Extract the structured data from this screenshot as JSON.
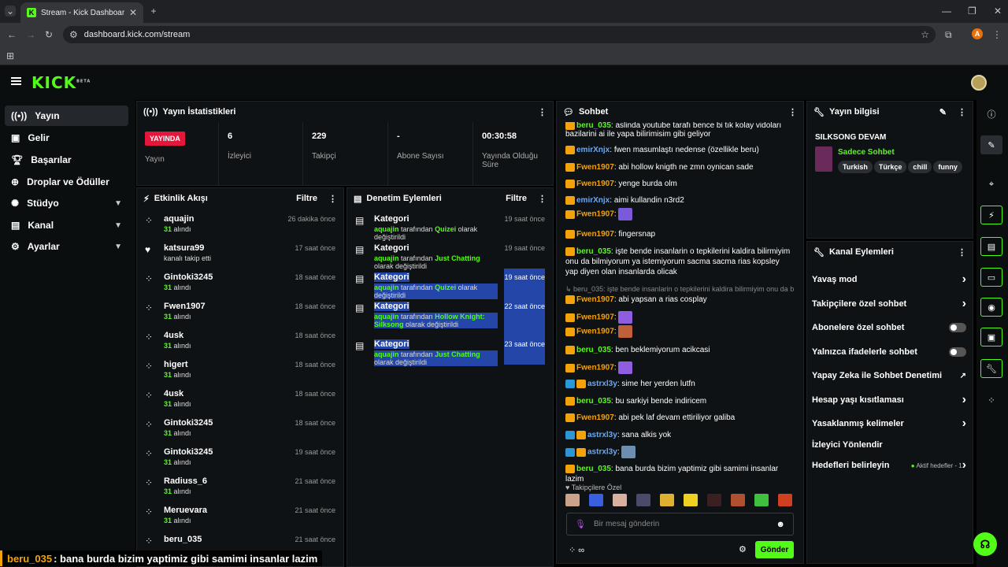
{
  "browser": {
    "tab_title": "Stream - Kick Dashboard",
    "url": "dashboard.kick.com/stream",
    "profile_initial": "A"
  },
  "header": {
    "logo": "KICK",
    "logo_badge": "BETA"
  },
  "sidebar": {
    "items": [
      {
        "label": "Yayın"
      },
      {
        "label": "Gelir"
      },
      {
        "label": "Başarılar"
      },
      {
        "label": "Droplar ve Ödüller"
      },
      {
        "label": "Stüdyo"
      },
      {
        "label": "Kanal"
      },
      {
        "label": "Ayarlar"
      }
    ]
  },
  "stats": {
    "title": "Yayın İstatistikleri",
    "live_badge": "YAYINDA",
    "live_label": "Yayın",
    "viewers": "6",
    "viewers_label": "İzleyici",
    "followers": "229",
    "followers_label": "Takipçi",
    "subs": "-",
    "subs_label": "Abone Sayısı",
    "duration": "00:30:58",
    "duration_label": "Yayında Olduğu Süre"
  },
  "activity": {
    "title": "Etkinlik Akışı",
    "filter": "Filtre",
    "items": [
      {
        "name": "aquajin",
        "amount": "31",
        "suffix": "alındı",
        "time": "26 dakika önce",
        "icon": "dots"
      },
      {
        "name": "katsura99",
        "sub": "kanalı takip etti",
        "time": "17 saat önce",
        "icon": "heart"
      },
      {
        "name": "Gintoki3245",
        "amount": "31",
        "suffix": "alındı",
        "time": "18 saat önce",
        "icon": "dots"
      },
      {
        "name": "Fwen1907",
        "amount": "31",
        "suffix": "alındı",
        "time": "18 saat önce",
        "icon": "dots"
      },
      {
        "name": "4usk",
        "amount": "31",
        "suffix": "alındı",
        "time": "18 saat önce",
        "icon": "dots"
      },
      {
        "name": "higert",
        "amount": "31",
        "suffix": "alındı",
        "time": "18 saat önce",
        "icon": "dots"
      },
      {
        "name": "4usk",
        "amount": "31",
        "suffix": "alındı",
        "time": "18 saat önce",
        "icon": "dots"
      },
      {
        "name": "Gintoki3245",
        "amount": "31",
        "suffix": "alındı",
        "time": "18 saat önce",
        "icon": "dots"
      },
      {
        "name": "Gintoki3245",
        "amount": "31",
        "suffix": "alındı",
        "time": "19 saat önce",
        "icon": "dots"
      },
      {
        "name": "Radiuss_6",
        "amount": "31",
        "suffix": "alındı",
        "time": "21 saat önce",
        "icon": "dots"
      },
      {
        "name": "Meruevara",
        "amount": "31",
        "suffix": "alındı",
        "time": "21 saat önce",
        "icon": "dots"
      },
      {
        "name": "beru_035",
        "amount": "",
        "suffix": "",
        "time": "21 saat önce",
        "icon": "dots"
      }
    ]
  },
  "moderation": {
    "title": "Denetim Eylemleri",
    "filter": "Filtre",
    "items": [
      {
        "title": "Kategori",
        "user": "aquajin",
        "mid": "tarafından",
        "cat": "Quizei",
        "end": "olarak değiştirildi",
        "time": "19 saat önce",
        "hl": false
      },
      {
        "title": "Kategori",
        "user": "aquajin",
        "mid": "tarafından",
        "cat": "Just Chatting",
        "end": "olarak değiştirildi",
        "time": "19 saat önce",
        "hl": false
      },
      {
        "title": "Kategori",
        "user": "aquajin",
        "mid": "tarafından",
        "cat": "Quizei",
        "end": "olarak değiştirildi",
        "time": "19 saat önce",
        "hl": true
      },
      {
        "title": "Kategori",
        "user": "aquajin",
        "mid": "tarafından",
        "cat": "Hollow Knight: Silksong",
        "end": "olarak değiştirildi",
        "time": "22 saat önce",
        "hl": true
      },
      {
        "title": "Kategori",
        "user": "aquajin",
        "mid": "tarafından",
        "cat": "Just Chatting",
        "end": "olarak değiştirildi",
        "time": "23 saat önce",
        "hl": true
      }
    ]
  },
  "chat": {
    "title": "Sohbet",
    "followers_only": "Takipçilere Özel",
    "placeholder": "Bir mesaj gönderin",
    "send": "Gönder",
    "messages": [
      {
        "user": "beru_035",
        "color": "gr",
        "text": "aslinda youtube tarafı bence bi tık kolay vidoları bazilarini ai ile yapa bilirimisim gibi geliyor",
        "badges": "c"
      },
      {
        "user": "emirXnjx",
        "color": "bl",
        "text": "fwen masumlaştı nedense (özellikle beru)",
        "badges": "c"
      },
      {
        "user": "Fwen1907",
        "color": "or",
        "text": "abi hollow knigth ne zmn oynican sade",
        "badges": "c"
      },
      {
        "user": "Fwen1907",
        "color": "or",
        "text": "yenge burda olm",
        "badges": "c"
      },
      {
        "user": "emirXnjx",
        "color": "bl",
        "text": "aimi kullandin n3rd2",
        "badges": "c"
      },
      {
        "user": "Fwen1907",
        "color": "or",
        "text": "",
        "badges": "c",
        "emote": "#7a5ad8"
      },
      {
        "user": "Fwen1907",
        "color": "or",
        "text": "fingersnap",
        "badges": "c"
      },
      {
        "user": "beru_035",
        "color": "gr",
        "text": "işte bende insanlarin o tepkilerini kaldira bilirmiyim onu da bilmiyorum ya istemiyorum sacma sacma rias kopsley yap diyen olan insanlarda olicak",
        "badges": "c"
      },
      {
        "user": "",
        "color": "",
        "text": "↳ beru_035: işte bende insanlarin o tepkilerini kaldira bilirmiyim onu da b...",
        "badges": "",
        "reply": true
      },
      {
        "user": "Fwen1907",
        "color": "or",
        "text": "abi yapsan a rias cosplay",
        "badges": "c"
      },
      {
        "user": "Fwen1907",
        "color": "or",
        "text": "",
        "badges": "c",
        "emote": "#8f5de0"
      },
      {
        "user": "Fwen1907",
        "color": "or",
        "text": "",
        "badges": "c",
        "emote": "#c0603a"
      },
      {
        "user": "beru_035",
        "color": "gr",
        "text": "ben beklemiyorum acikcasi",
        "badges": "c"
      },
      {
        "user": "Fwen1907",
        "color": "or",
        "text": "",
        "badges": "c",
        "emote": "#8f5de0"
      },
      {
        "user": "astrxl3y",
        "color": "bl",
        "text": "sime her yerden lutfn",
        "badges": "bc"
      },
      {
        "user": "beru_035",
        "color": "gr",
        "text": "bu sarkiyi bende indiricem",
        "badges": "c"
      },
      {
        "user": "Fwen1907",
        "color": "or",
        "text": "abi pek laf devam ettiriliyor galiba",
        "badges": "c"
      },
      {
        "user": "astrxl3y",
        "color": "bl",
        "text": "sana alkis yok",
        "badges": "bc"
      },
      {
        "user": "astrxl3y",
        "color": "bl",
        "text": "",
        "badges": "bc",
        "emote": "#6c8fb0"
      },
      {
        "user": "beru_035",
        "color": "gr",
        "text": "bana burda bizim yaptimiz gibi samimi insanlar lazim",
        "badges": "c"
      }
    ]
  },
  "stream_info": {
    "title": "Yayın bilgisi",
    "stream_title": "SILKSONG DEVAM",
    "category": "Sadece Sohbet",
    "tags": [
      "Turkish",
      "Türkçe",
      "chill",
      "funny"
    ]
  },
  "channel_actions": {
    "title": "Kanal Eylemleri",
    "items": [
      {
        "label": "Yavaş mod",
        "control": "chevron"
      },
      {
        "label": "Takipçilere özel sohbet",
        "control": "chevron"
      },
      {
        "label": "Abonelere özel sohbet",
        "control": "toggle"
      },
      {
        "label": "Yalnızca ifadelerle sohbet",
        "control": "toggle"
      },
      {
        "label": "Yapay Zeka ile Sohbet Denetimi",
        "control": "ext"
      },
      {
        "label": "Hesap yaşı kısıtlaması",
        "control": "chevron"
      },
      {
        "label": "Yasaklanmış kelimeler",
        "control": "chevron"
      },
      {
        "label": "İzleyici Yönlendir",
        "control": "none"
      },
      {
        "label": "Hedefleri belirleyin",
        "control": "goals",
        "extra": "Aktif hedefler - 1"
      }
    ]
  },
  "overlay": {
    "user": "beru_035",
    "text": ": bana burda bizim yaptimiz gibi samimi insanlar lazim"
  },
  "colors": {
    "accent": "#53fc18",
    "live": "#e4163c",
    "highlight": "#2346a8"
  }
}
